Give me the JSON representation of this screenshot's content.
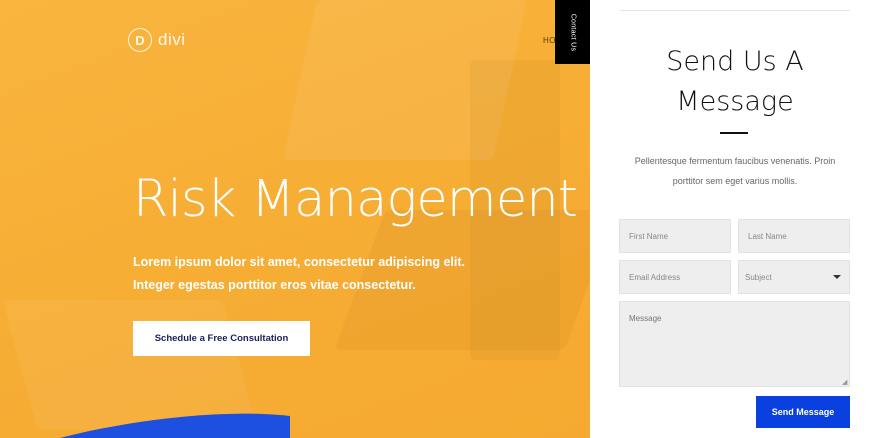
{
  "brand": {
    "logo_letter": "D",
    "logo_text": "divi"
  },
  "nav": {
    "partial_item": "HO"
  },
  "side_tab": {
    "label": "Contact Us"
  },
  "hero": {
    "title": "Risk Management",
    "subtitle_line1": "Lorem ipsum dolor sit amet, consectetur adipiscing elit.",
    "subtitle_line2": "Integer egestas porttitor eros vitae consectetur.",
    "cta_label": "Schedule a Free Consultation"
  },
  "contact_form": {
    "title_line1": "Send Us A",
    "title_line2": "Message",
    "description_line1": "Pellentesque fermentum faucibus venenatis. Proin",
    "description_line2": "porttitor sem eget varius mollis.",
    "first_name_placeholder": "First Name",
    "last_name_placeholder": "Last Name",
    "email_placeholder": "Email Address",
    "subject_selected": "Subject",
    "message_placeholder": "Message",
    "submit_label": "Send Message"
  },
  "colors": {
    "hero_background": "#f8b23c",
    "primary_button": "#0a3fe0",
    "cta_text": "#1a1f5c",
    "side_tab": "#000000",
    "wave": "#1d4fe0"
  },
  "icons": {
    "subject_dropdown": "chevron-down-icon",
    "textarea_resize": "resize-grip-icon"
  }
}
